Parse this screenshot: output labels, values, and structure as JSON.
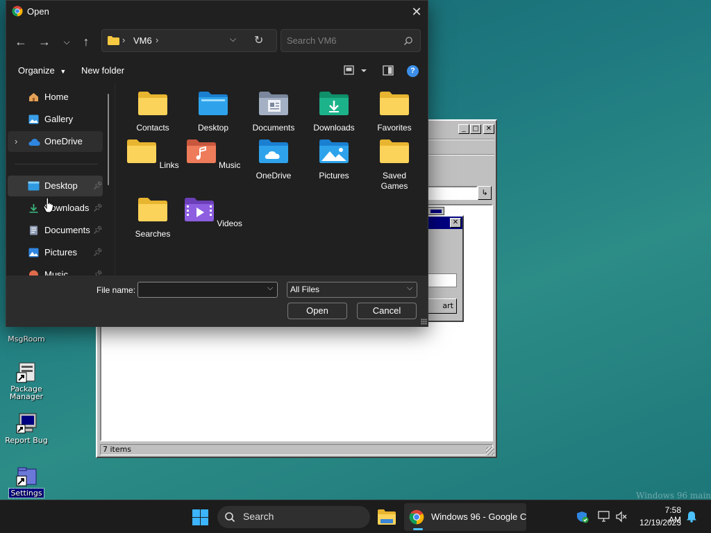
{
  "desktop": {
    "icons": [
      {
        "label": "MsgRoom"
      },
      {
        "label": "Package\nManager"
      },
      {
        "label": "Report Bug"
      },
      {
        "label": "Settings"
      }
    ],
    "watermark": "Windows 96 main"
  },
  "bg_window": {
    "status": "7 items",
    "sub_button_fragment": "art"
  },
  "dialog": {
    "title": "Open",
    "address": {
      "path_segment": "VM6"
    },
    "search_placeholder": "Search VM6",
    "commands": {
      "organize": "Organize",
      "new_folder": "New folder"
    },
    "nav_items": [
      {
        "label": "Home",
        "icon": "home-icon",
        "pinned": false
      },
      {
        "label": "Gallery",
        "icon": "gallery-icon",
        "pinned": false
      },
      {
        "label": "OneDrive",
        "icon": "onedrive-icon",
        "pinned": false,
        "expandable": true
      },
      {
        "label": "Desktop",
        "icon": "desktop-icon",
        "pinned": true,
        "selected": true
      },
      {
        "label": "Downloads",
        "icon": "downloads-icon",
        "pinned": true
      },
      {
        "label": "Documents",
        "icon": "documents-icon",
        "pinned": true
      },
      {
        "label": "Pictures",
        "icon": "pictures-icon",
        "pinned": true
      },
      {
        "label": "Music",
        "icon": "music-icon",
        "pinned": true
      }
    ],
    "folders": [
      {
        "label": "Contacts",
        "icon": "folder-icon"
      },
      {
        "label": "Desktop",
        "icon": "desktop-folder-icon"
      },
      {
        "label": "Documents",
        "icon": "documents-folder-icon"
      },
      {
        "label": "Downloads",
        "icon": "downloads-folder-icon"
      },
      {
        "label": "Favorites",
        "icon": "folder-icon"
      },
      {
        "label": "Links",
        "icon": "folder-icon"
      },
      {
        "label": "Music",
        "icon": "music-folder-icon"
      },
      {
        "label": "OneDrive",
        "icon": "onedrive-folder-icon"
      },
      {
        "label": "Pictures",
        "icon": "pictures-folder-icon"
      },
      {
        "label": "Saved\nGames",
        "icon": "folder-icon"
      },
      {
        "label": "Searches",
        "icon": "folder-icon"
      },
      {
        "label": "Videos",
        "icon": "videos-folder-icon"
      }
    ],
    "file_name_label": "File name:",
    "file_name_value": "",
    "filter_value": "All Files",
    "open_label": "Open",
    "cancel_label": "Cancel"
  },
  "taskbar": {
    "search_label": "Search",
    "active_app_label": "Windows 96 - Google C",
    "time": "7:58 AM",
    "date": "12/19/2023"
  },
  "colors": {
    "accent": "#4cc2ff",
    "folder_yellow": "#f6c940",
    "dialog_bg": "#202020"
  }
}
